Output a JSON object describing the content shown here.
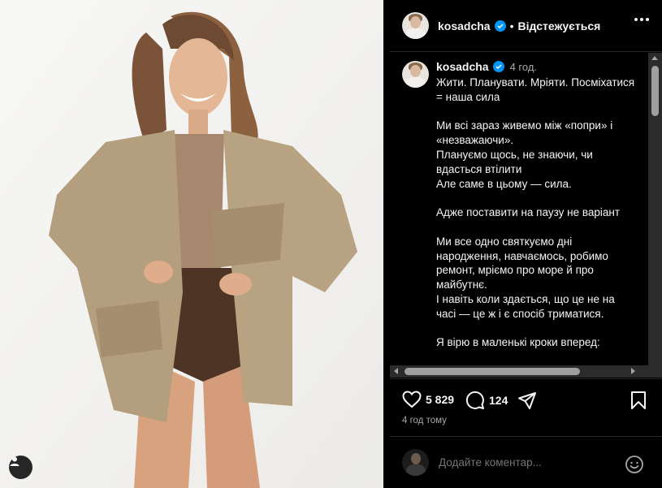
{
  "post": {
    "username": "kosadcha",
    "follow_status": "Відстежується",
    "time_ago": "4 год.",
    "caption_lines": [
      "Жити. Планувати. Мріяти. Посміхатися",
      "= наша сила",
      "",
      "Ми всі зараз живемо між «попри» і",
      "«незважаючи».",
      "Плануємо щось, не знаючи, чи",
      "вдасться втілити",
      "Але саме в цьому — сила.",
      "",
      "Адже поставити на паузу не варіант",
      "",
      "Ми все одно святкуємо дні",
      "народження, навчаємось, робимо",
      "ремонт, мріємо про море й про",
      "майбутнє.",
      "І навіть коли здається, що це не на",
      "часі — це ж і є спосіб триматися.",
      "",
      "Я вірю в маленькі кроки вперед:"
    ],
    "likes": "5 829",
    "comments": "124",
    "posted_ago": "4 год тому"
  },
  "comment": {
    "placeholder": "Додайте коментар..."
  },
  "icons": {
    "verified": "verified-badge-icon",
    "more": "more-options-icon",
    "like": "heart-icon",
    "comment": "comment-icon",
    "share": "share-icon",
    "save": "bookmark-icon",
    "emoji": "emoji-icon",
    "tagged": "user-tag-icon"
  },
  "colors": {
    "verified": "#0095f6",
    "background": "#000000",
    "muted_text": "#a8a8a8"
  }
}
